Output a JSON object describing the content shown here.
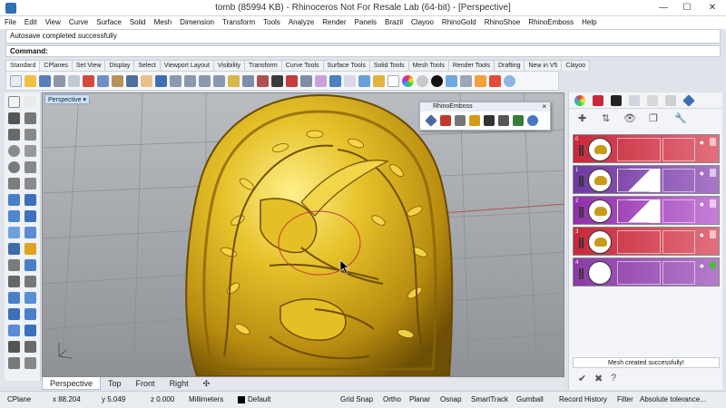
{
  "window": {
    "title": "tomb (85994 KB) - Rhinoceros Not For Resale Lab (64-bit) - [Perspective]",
    "minimize": "—",
    "maximize": "☐",
    "close": "✕"
  },
  "menu": [
    "File",
    "Edit",
    "View",
    "Curve",
    "Surface",
    "Solid",
    "Mesh",
    "Dimension",
    "Transform",
    "Tools",
    "Analyze",
    "Render",
    "Panels",
    "Brazil",
    "Clayoo",
    "RhinoGold",
    "RhinoShoe",
    "RhinoEmboss",
    "Help"
  ],
  "command": {
    "history": "Autosave completed successfully",
    "prompt": "Command:"
  },
  "toolbar_tabs": [
    "Standard",
    "CPlanes",
    "Set View",
    "Display",
    "Select",
    "Viewport Layout",
    "Visibility",
    "Transform",
    "Curve Tools",
    "Surface Tools",
    "Solid Tools",
    "Mesh Tools",
    "Render Tools",
    "Drafting",
    "New in V5",
    "Clayoo"
  ],
  "viewport": {
    "label": "Perspective",
    "dropdown": "▾"
  },
  "rhinoemboss_panel": {
    "title": "RhinoEmboss",
    "close": "×"
  },
  "view_tabs": [
    "Perspective",
    "Top",
    "Front",
    "Right"
  ],
  "add_view": "✣",
  "layers_panel": {
    "layers": [
      {
        "number": "0"
      },
      {
        "number": "1"
      },
      {
        "number": "2"
      },
      {
        "number": "3"
      },
      {
        "number": "4"
      }
    ],
    "status": "Mesh created successfully!"
  },
  "statusbar": {
    "cplane": "CPlane",
    "x": "x 88.204",
    "y": "y 5.049",
    "z": "z 0.000",
    "units": "Millimeters",
    "layer": "Default",
    "toggles": [
      "Grid Snap",
      "Ortho",
      "Planar",
      "Osnap",
      "SmartTrack",
      "Gumball",
      "Record History",
      "Filter",
      "Absolute tolerance..."
    ]
  },
  "colors": {
    "gold": "#c99a1a",
    "layer_red": "#c8283a",
    "layer_purple": "#8a3aa6",
    "layer_violet": "#9b34b2",
    "viewport_bg": "#9fa3a8"
  }
}
